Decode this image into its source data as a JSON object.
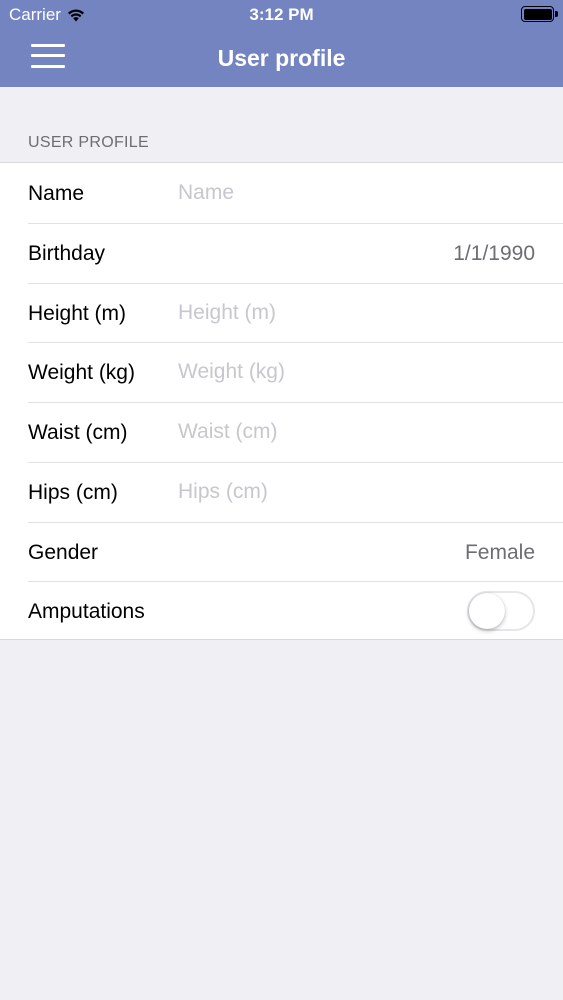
{
  "status_bar": {
    "carrier": "Carrier",
    "time": "3:12 PM",
    "battery_level": 1.0
  },
  "nav": {
    "title": "User profile",
    "menu_icon": "hamburger-menu-icon",
    "bar_color": "#7384c0"
  },
  "section": {
    "header": "USER PROFILE"
  },
  "fields": {
    "name": {
      "label": "Name",
      "placeholder": "Name"
    },
    "birthday": {
      "label": "Birthday",
      "value": "1/1/1990"
    },
    "height": {
      "label": "Height (m)",
      "placeholder": "Height (m)"
    },
    "weight": {
      "label": "Weight (kg)",
      "placeholder": "Weight (kg)"
    },
    "waist": {
      "label": "Waist (cm)",
      "placeholder": "Waist (cm)"
    },
    "hips": {
      "label": "Hips (cm)",
      "placeholder": "Hips (cm)"
    },
    "gender": {
      "label": "Gender",
      "value": "Female"
    },
    "amputations": {
      "label": "Amputations",
      "enabled": false
    }
  }
}
